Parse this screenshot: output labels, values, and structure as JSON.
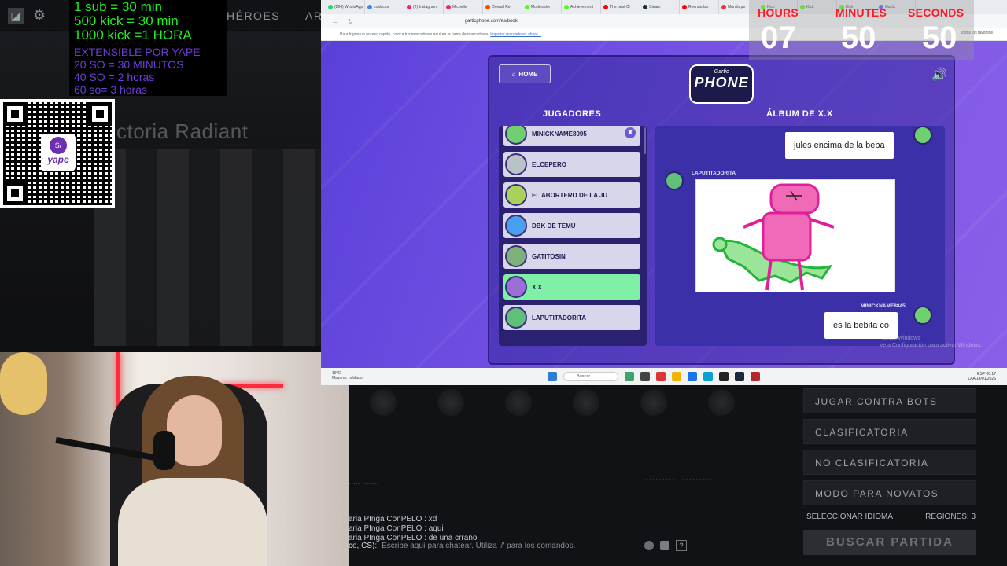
{
  "overlay": {
    "lines": [
      {
        "text": "1 sub = 30 min",
        "color": "#22ee22"
      },
      {
        "text": "500 kick = 30 min",
        "color": "#22ee22"
      },
      {
        "text": "1000 kick =1 HORA",
        "color": "#22ee22"
      },
      {
        "text": "EXTENSIBLE POR   YAPE",
        "color": "#6d3dd6"
      },
      {
        "text": "20 SO = 30 MINUTOS",
        "color": "#6d3dd6"
      },
      {
        "text": "40 SO = 2 horas",
        "color": "#6d3dd6"
      },
      {
        "text": "60 so= 3 horas",
        "color": "#6d3dd6"
      }
    ],
    "qr_brand": "yape",
    "qr_badge": "S/"
  },
  "game": {
    "nav_heroes": "HÉROES",
    "nav_next": "AR",
    "hero_title": "ctoria Radiant",
    "menu": [
      "JUGAR CONTRA BOTS",
      "CLASIFICATORIA",
      "NO CLASIFICATORIA",
      "MODO PARA NOVATOS"
    ],
    "select_language": "SELECCIONAR IDIOMA",
    "regions": "REGIONES: 3",
    "find_match": "BUSCAR PARTIDA",
    "chat_lines": [
      {
        "name": "aria PInga ConPELO",
        "msg": ": xd"
      },
      {
        "name": "aria PInga ConPELO",
        "msg": ": aqui"
      },
      {
        "name": "aria PInga ConPELO",
        "msg": ": de una crrano"
      }
    ],
    "chat_prefix": "co, CS):",
    "chat_placeholder": "Escribe aquí para chatear. Utiliza '/' para los comandos.",
    "chat_help": "?"
  },
  "browser": {
    "tabs": [
      {
        "label": "(204) WhatsApp",
        "color": "#25d366"
      },
      {
        "label": "traductor",
        "color": "#4285f4"
      },
      {
        "label": "(2) Instagram",
        "color": "#e1306c"
      },
      {
        "label": "Michelle",
        "color": "#e1306c"
      },
      {
        "label": "Overall Re",
        "color": "#ff4500"
      },
      {
        "label": "Moderador",
        "color": "#53fc18"
      },
      {
        "label": "Achievement",
        "color": "#53fc18"
      },
      {
        "label": "The best Cl",
        "color": "#ff0000"
      },
      {
        "label": "Steam",
        "color": "#1b2838"
      },
      {
        "label": "Reembolso",
        "color": "#ff0000"
      },
      {
        "label": "Mundo pe",
        "color": "#e53935"
      },
      {
        "label": "Kick",
        "color": "#53fc18"
      },
      {
        "label": "Kick",
        "color": "#53fc18"
      },
      {
        "label": "Kick",
        "color": "#53fc18"
      },
      {
        "label": "Gartic",
        "color": "#7b56e6"
      }
    ],
    "url": "garticphone.com/es/book",
    "bookmarks_text": "Para lograr un acceso rápido, coloca tus marcadores aquí en la barra de marcadores.",
    "bookmarks_link": "Importar marcadores ahora...",
    "bookmarks_right": "Todos los favoritos"
  },
  "gartic": {
    "home_label": "HOME",
    "logo_small": "Gartic",
    "logo_big": "PHONE",
    "players_title": "JUGADORES",
    "album_title": "ÁLBUM DE X.X",
    "players": [
      {
        "name": "MINICKNAME8095",
        "color": "#6fd06f",
        "host": true,
        "active": false
      },
      {
        "name": "ELCEPERO",
        "color": "#b9c3c6",
        "host": false,
        "active": false
      },
      {
        "name": "EL ABORTERO DE LA JU",
        "color": "#a7d35a",
        "host": false,
        "active": false
      },
      {
        "name": "DBK DE TEMU",
        "color": "#4aa0f0",
        "host": false,
        "active": false
      },
      {
        "name": "GATITOSIN",
        "color": "#7fb07a",
        "host": false,
        "active": false
      },
      {
        "name": "X.X",
        "color": "#9b6fd6",
        "host": false,
        "active": true
      },
      {
        "name": "LAPUTITADORITA",
        "color": "#5fc07a",
        "host": false,
        "active": false
      }
    ],
    "album": {
      "first_text": "jules encima de la beba",
      "drawing_author": "LAPUTITADORITA",
      "last_author": "MINICKNAME8845",
      "last_text": "es la bebita co"
    },
    "activate_windows": [
      "Activar Windows",
      "Ve a Configuración para activar Windows."
    ]
  },
  "taskbar": {
    "weather_temp": "19°C",
    "weather_desc": "Mayorm. nublado",
    "search": "Buscar",
    "lang": "ESP",
    "lang2": "LAA",
    "time": "00:17",
    "date": "14/01/2026"
  },
  "timer": {
    "hours_label": "HOURS",
    "minutes_label": "MINUTES",
    "seconds_label": "SECONDS",
    "hours": "07",
    "minutes": "50",
    "seconds": "50"
  }
}
